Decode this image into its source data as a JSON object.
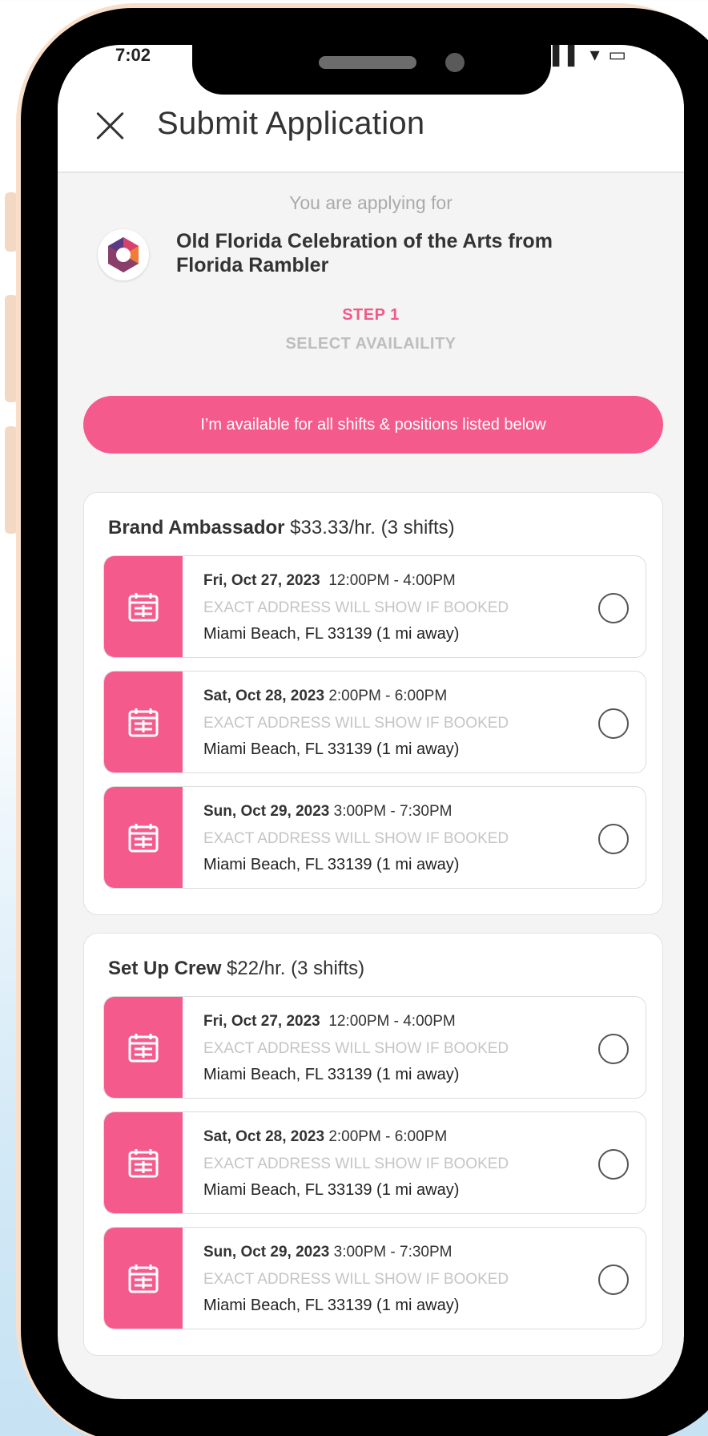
{
  "status_bar": {
    "time": "7:02",
    "icons": "▌▌▌ ▾ ▭"
  },
  "appbar": {
    "title": "Submit Application"
  },
  "applying_label": "You are applying for",
  "event": {
    "title": "Old Florida Celebration of the Arts from Florida Rambler"
  },
  "step": {
    "label": "STEP 1",
    "sub": "SELECT AVAILAILITY"
  },
  "available_all_label": "I’m available for all shifts & positions listed below",
  "colors": {
    "accent": "#f55a8d",
    "step": "#f05a8a"
  },
  "positions": [
    {
      "name": "Brand Ambassador",
      "rate": "$33.33/hr. (3 shifts)",
      "shifts": [
        {
          "date": "Fri, Oct 27, 2023",
          "time": "12:00PM - 4:00PM",
          "note": "EXACT ADDRESS WILL SHOW IF BOOKED",
          "location": "Miami Beach, FL 33139  (1 mi away)"
        },
        {
          "date": "Sat, Oct 28, 2023",
          "time": "2:00PM - 6:00PM",
          "note": "EXACT ADDRESS WILL SHOW IF BOOKED",
          "location": "Miami Beach, FL 33139  (1 mi away)"
        },
        {
          "date": "Sun, Oct 29, 2023",
          "time": "3:00PM - 7:30PM",
          "note": "EXACT ADDRESS WILL SHOW IF BOOKED",
          "location": "Miami Beach, FL 33139  (1 mi away)"
        }
      ]
    },
    {
      "name": "Set Up Crew",
      "rate": "$22/hr. (3 shifts)",
      "shifts": [
        {
          "date": "Fri, Oct 27, 2023",
          "time": "12:00PM - 4:00PM",
          "note": "EXACT ADDRESS WILL SHOW IF BOOKED",
          "location": "Miami Beach, FL 33139  (1 mi away)"
        },
        {
          "date": "Sat, Oct 28, 2023",
          "time": "2:00PM - 6:00PM",
          "note": "EXACT ADDRESS WILL SHOW IF BOOKED",
          "location": "Miami Beach, FL 33139  (1 mi away)"
        },
        {
          "date": "Sun, Oct 29, 2023",
          "time": "3:00PM - 7:30PM",
          "note": "EXACT ADDRESS WILL SHOW IF BOOKED",
          "location": "Miami Beach, FL 33139  (1 mi away)"
        }
      ]
    }
  ]
}
